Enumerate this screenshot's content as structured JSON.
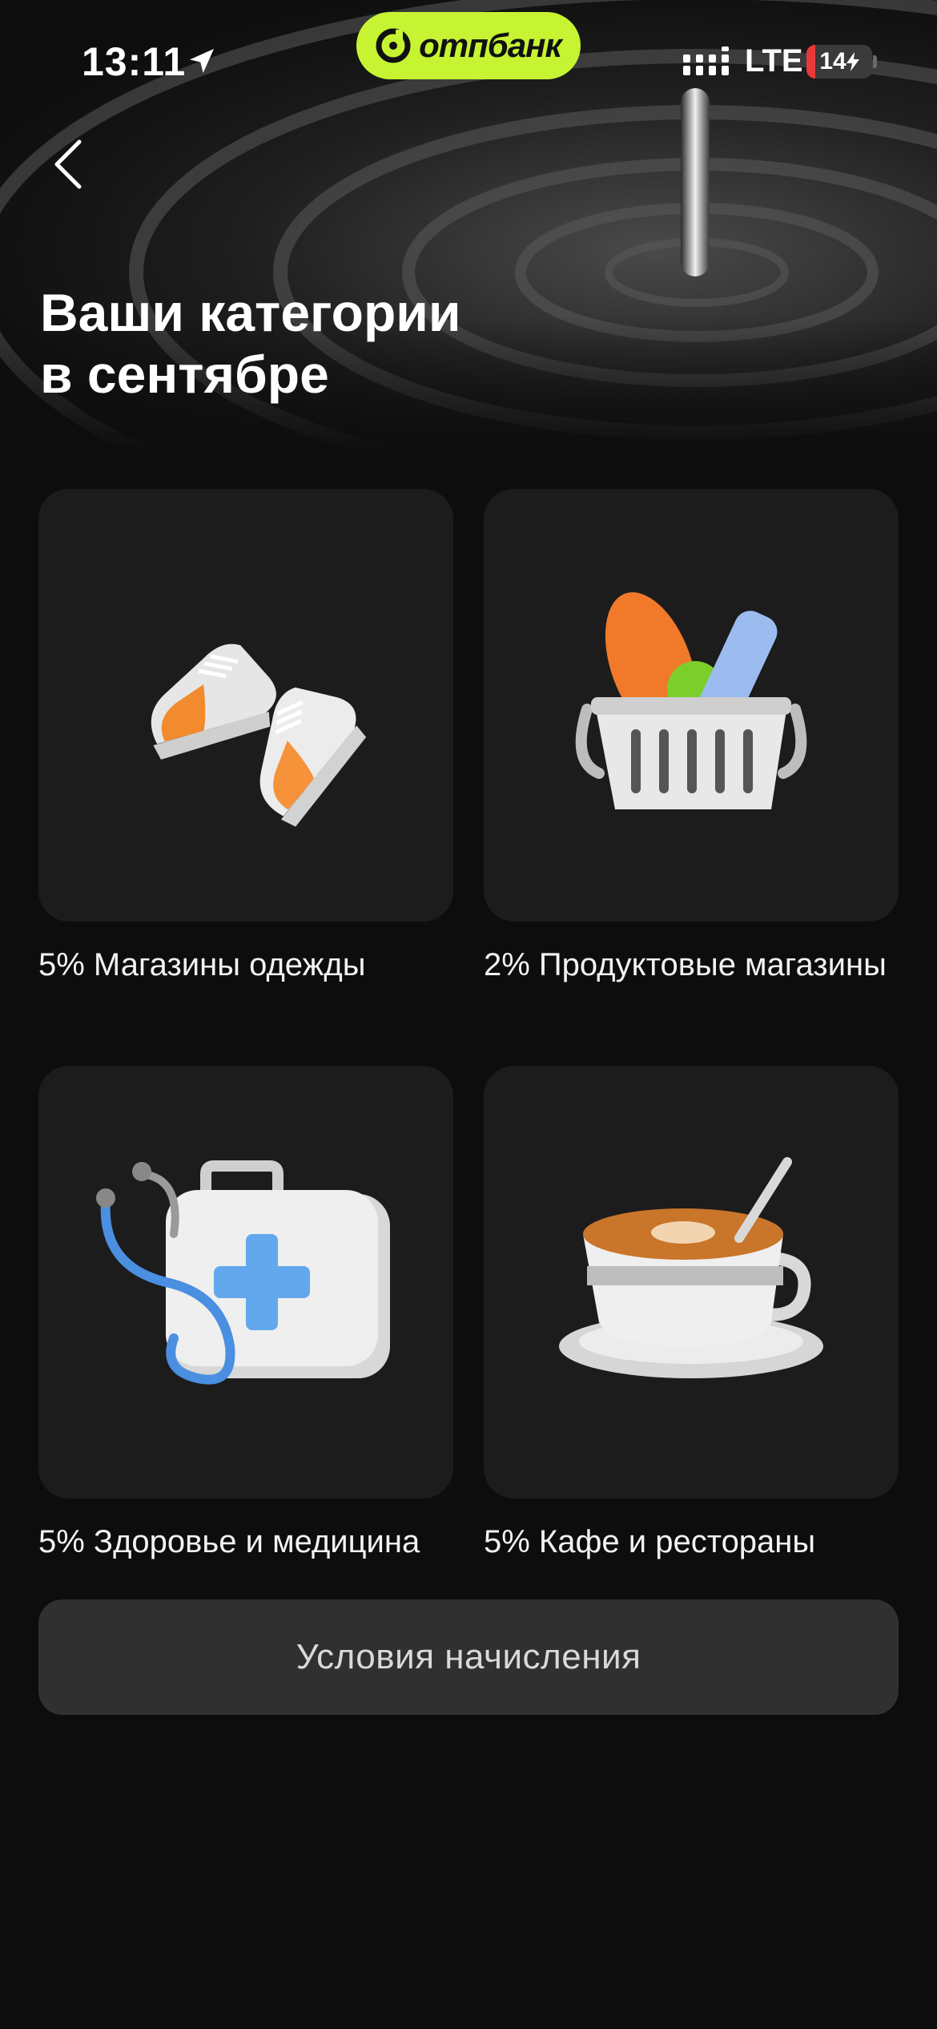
{
  "status_bar": {
    "time": "13:11",
    "network": "LTE",
    "battery_level": "14",
    "battery_fraction": 0.14
  },
  "brand": {
    "name": "отпбанк",
    "color": "#c6f432"
  },
  "page": {
    "title": "Ваши категории\nв сентябре"
  },
  "categories": [
    {
      "label": "5% Магазины одежды",
      "icon": "sneakers-icon"
    },
    {
      "label": "2% Продуктовые магазины",
      "icon": "grocery-basket-icon"
    },
    {
      "label": "5% Здоровье и медицина",
      "icon": "medical-kit-icon"
    },
    {
      "label": "5% Кафе и рестораны",
      "icon": "coffee-cup-icon"
    }
  ],
  "cta": {
    "label": "Условия начисления"
  }
}
